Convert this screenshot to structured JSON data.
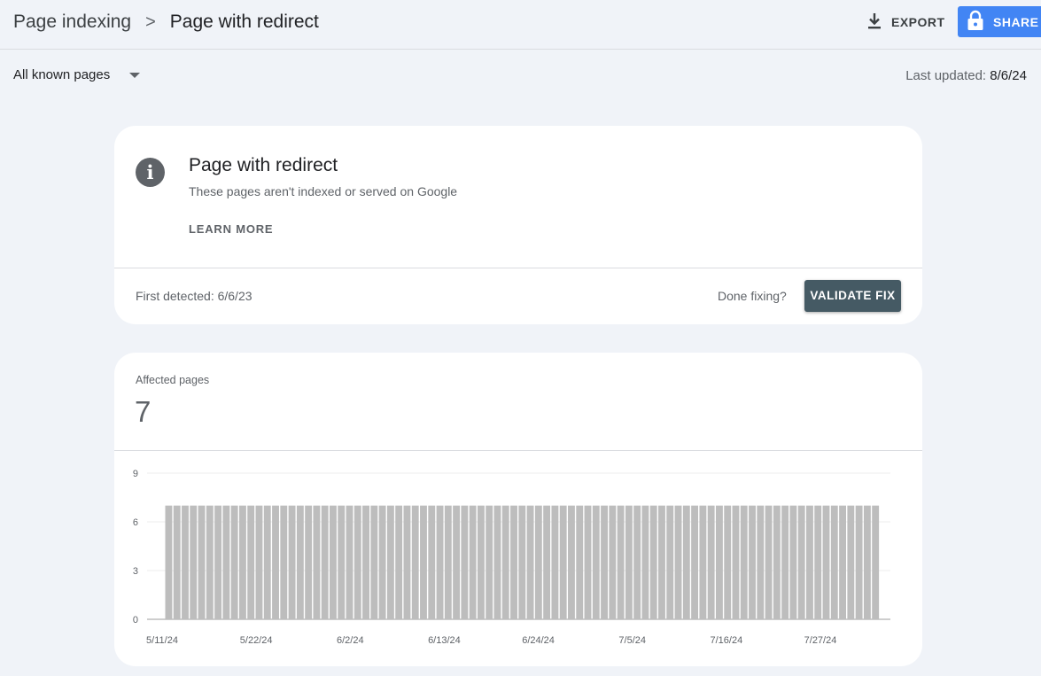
{
  "header": {
    "breadcrumb_parent": "Page indexing",
    "breadcrumb_separator": ">",
    "breadcrumb_current": "Page with redirect",
    "export_label": "EXPORT",
    "share_label": "SHARE"
  },
  "filter": {
    "selected": "All known pages",
    "last_updated_label": "Last updated:",
    "last_updated_value": "8/6/24"
  },
  "issue": {
    "title": "Page with redirect",
    "description": "These pages aren't indexed or served on Google",
    "learn_more": "LEARN MORE",
    "first_detected": "First detected: 6/6/23",
    "done_fixing": "Done fixing?",
    "validate_fix": "VALIDATE FIX"
  },
  "metric": {
    "label": "Affected pages",
    "value": "7"
  },
  "colors": {
    "accent": "#4285f4",
    "validate_button": "#455a64",
    "bar": "#bdbdbd",
    "background": "#f0f3f8"
  },
  "chart_data": {
    "type": "bar",
    "x_start": "5/11/24",
    "x_end": "8/5/24",
    "x_step_days": 1,
    "values": [
      7,
      7,
      7,
      7,
      7,
      7,
      7,
      7,
      7,
      7,
      7,
      7,
      7,
      7,
      7,
      7,
      7,
      7,
      7,
      7,
      7,
      7,
      7,
      7,
      7,
      7,
      7,
      7,
      7,
      7,
      7,
      7,
      7,
      7,
      7,
      7,
      7,
      7,
      7,
      7,
      7,
      7,
      7,
      7,
      7,
      7,
      7,
      7,
      7,
      7,
      7,
      7,
      7,
      7,
      7,
      7,
      7,
      7,
      7,
      7,
      7,
      7,
      7,
      7,
      7,
      7,
      7,
      7,
      7,
      7,
      7,
      7,
      7,
      7,
      7,
      7,
      7,
      7,
      7,
      7,
      7,
      7,
      7,
      7,
      7,
      7,
      7
    ],
    "x_tick_labels": [
      "5/11/24",
      "5/22/24",
      "6/2/24",
      "6/13/24",
      "6/24/24",
      "7/5/24",
      "7/16/24",
      "7/27/24"
    ],
    "y_ticks": [
      0,
      3,
      6,
      9
    ],
    "ylim": [
      0,
      9
    ],
    "grid": true
  }
}
